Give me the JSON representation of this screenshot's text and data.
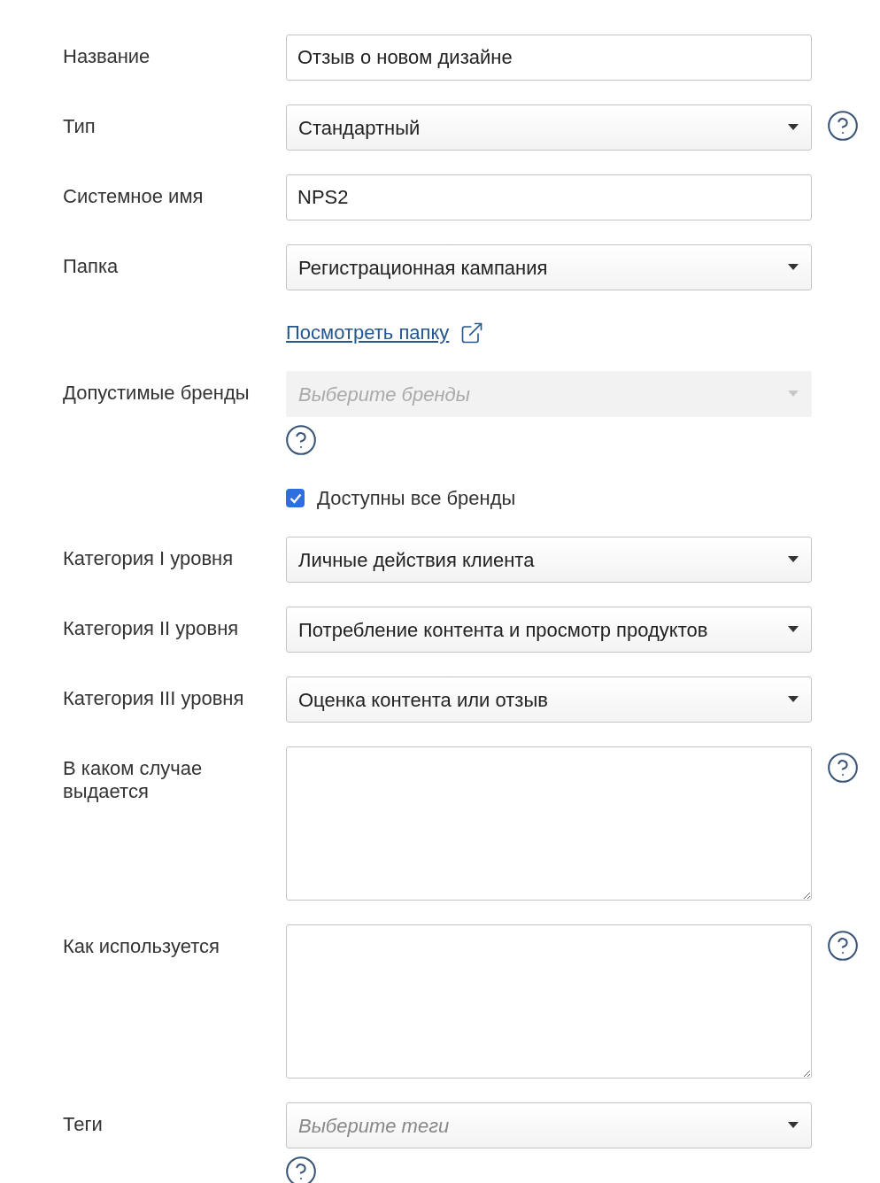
{
  "fields": [
    {
      "kind": "text",
      "label": "Название",
      "value": "Отзыв о новом дизайне",
      "disabled": false,
      "help_side": false,
      "help_below": false
    },
    {
      "kind": "select",
      "label": "Тип",
      "value": "Стандартный",
      "disabled": false,
      "help_side": true,
      "help_below": false
    },
    {
      "kind": "text",
      "label": "Системное имя",
      "value": "NPS2",
      "disabled": false,
      "help_side": false,
      "help_below": false
    },
    {
      "kind": "select",
      "label": "Папка",
      "value": "Регистрационная кампания",
      "disabled": false,
      "help_side": false,
      "help_below": false,
      "link": "Посмотреть папку"
    },
    {
      "kind": "select",
      "label": "Допустимые бренды",
      "placeholder": "Выберите бренды",
      "disabled": true,
      "help_side": false,
      "help_below": true,
      "checkbox": {
        "label": "Доступны все бренды",
        "checked": true
      }
    },
    {
      "kind": "select",
      "label": "Категория I уровня",
      "value": "Личные действия клиента",
      "disabled": false,
      "help_side": false,
      "help_below": false
    },
    {
      "kind": "select",
      "label": "Категория II уровня",
      "value": "Потребление контента и просмотр продуктов",
      "disabled": false,
      "help_side": false,
      "help_below": false
    },
    {
      "kind": "select",
      "label": "Категория III уровня",
      "value": "Оценка контента или отзыв",
      "disabled": false,
      "help_side": false,
      "help_below": false
    },
    {
      "kind": "textarea",
      "label": "В каком случае\nвыдается",
      "disabled": false,
      "help_side": true,
      "help_below": false
    },
    {
      "kind": "textarea",
      "label": "Как используется",
      "disabled": false,
      "help_side": true,
      "help_below": false
    },
    {
      "kind": "select",
      "label": "Теги",
      "placeholder": "Выберите теги",
      "disabled": false,
      "help_side": false,
      "help_below": true
    }
  ]
}
